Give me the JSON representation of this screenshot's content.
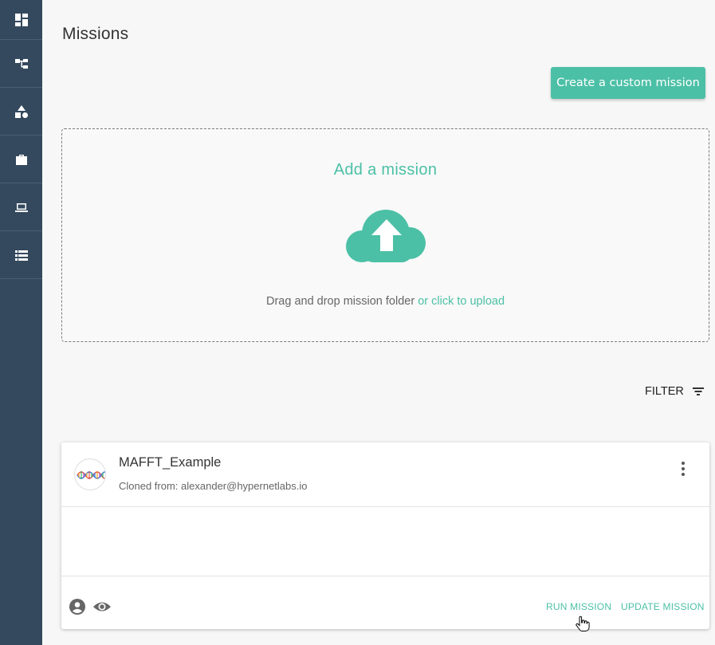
{
  "sidebar": {
    "items": [
      {
        "icon": "dashboard-icon"
      },
      {
        "icon": "hierarchy-icon"
      },
      {
        "icon": "shapes-icon"
      },
      {
        "icon": "briefcase-icon"
      },
      {
        "icon": "laptop-icon"
      },
      {
        "icon": "list-icon"
      }
    ]
  },
  "page": {
    "title": "Missions"
  },
  "toolbar": {
    "create_label": "Create a custom mission"
  },
  "dropzone": {
    "title": "Add a mission",
    "text": "Drag and drop mission folder",
    "link": "or click to upload",
    "icon": "cloud-upload-icon"
  },
  "filter": {
    "label": "FILTER",
    "icon": "filter-icon"
  },
  "mission": {
    "name": "MAFFT_Example",
    "cloned_from": "Cloned from: alexander@hypernetlabs.io",
    "run_label": "RUN MISSION",
    "update_label": "UPDATE MISSION"
  },
  "colors": {
    "accent": "#4cc0a6",
    "sidebar": "#34495e"
  }
}
